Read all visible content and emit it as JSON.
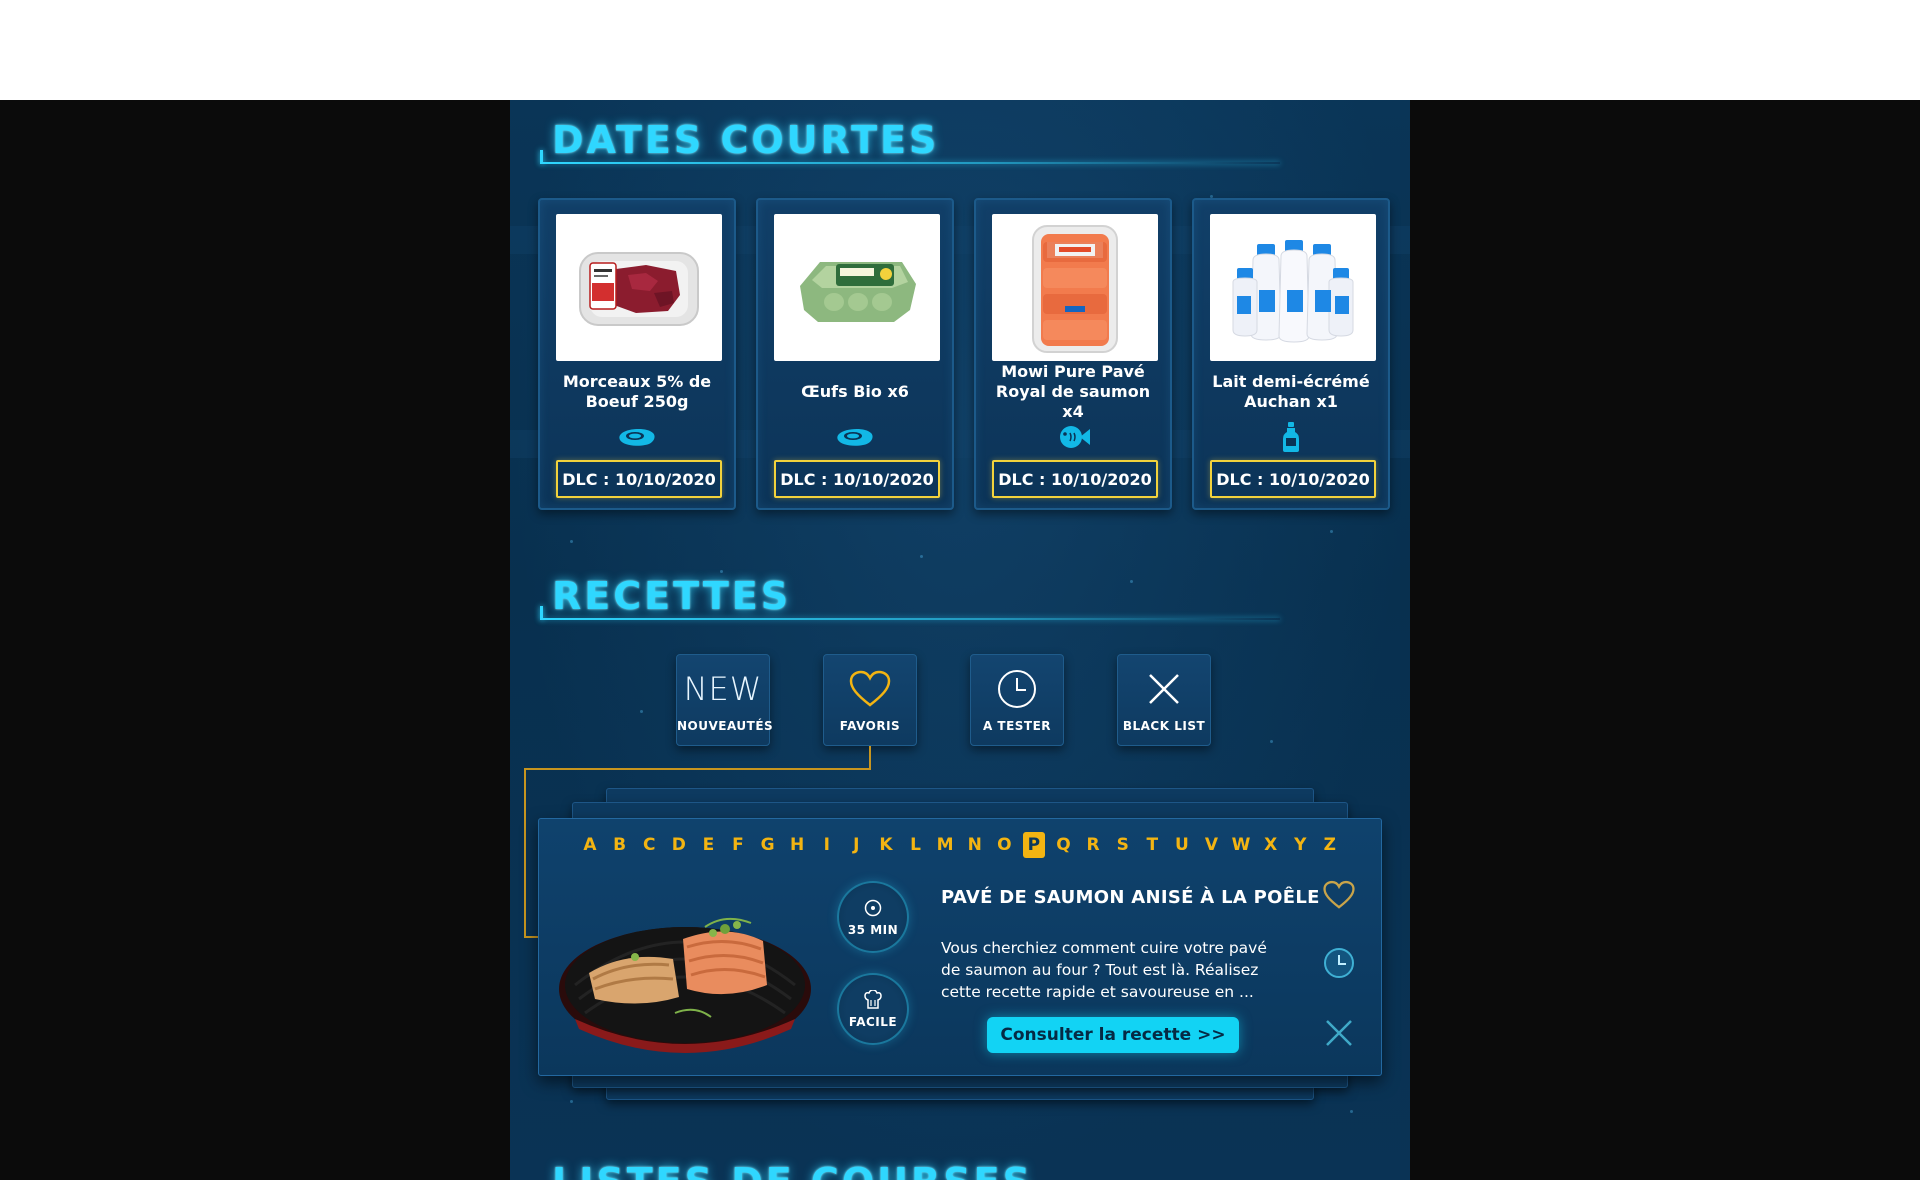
{
  "sections": {
    "dates_courtes": {
      "title": "Dates courtes"
    },
    "recettes": {
      "title": "Recettes"
    },
    "next_partial": {
      "title": "Listes de courses"
    }
  },
  "products": [
    {
      "name": "Morceaux 5% de Boeuf 250g",
      "dlc": "DLC : 10/10/2020",
      "category_icon": "meat-icon",
      "image": "beef-pack"
    },
    {
      "name": "Œufs Bio x6",
      "dlc": "DLC : 10/10/2020",
      "category_icon": "meat-icon",
      "image": "egg-carton"
    },
    {
      "name": "Mowi Pure Pavé Royal de saumon x4",
      "dlc": "DLC : 10/10/2020",
      "category_icon": "fish-icon",
      "image": "salmon-pack"
    },
    {
      "name": "Lait demi-écrémé Auchan x1",
      "dlc": "DLC : 10/10/2020",
      "category_icon": "bottle-icon",
      "image": "milk-bottles"
    }
  ],
  "filters": [
    {
      "label": "NOUVEAUTÉS",
      "icon": "new-icon",
      "icon_text": "NEW"
    },
    {
      "label": "FAVORIS",
      "icon": "heart-icon"
    },
    {
      "label": "A TESTER",
      "icon": "clock-icon"
    },
    {
      "label": "BLACK LIST",
      "icon": "cross-icon"
    }
  ],
  "alphabet": [
    "A",
    "B",
    "C",
    "D",
    "E",
    "F",
    "G",
    "H",
    "I",
    "J",
    "K",
    "L",
    "M",
    "N",
    "O",
    "P",
    "Q",
    "R",
    "S",
    "T",
    "U",
    "V",
    "W",
    "X",
    "Y",
    "Z"
  ],
  "alphabet_active": "P",
  "recipe": {
    "title": "PAVÉ DE SAUMON ANISÉ À LA POÊLE",
    "description": "Vous cherchiez comment cuire votre pavé de saumon au four ? Tout est là. Réalisez cette recette rapide et savoureuse en ...",
    "duration": "35 MIN",
    "difficulty": "FACILE",
    "cta": "Consulter la recette  >>"
  },
  "colors": {
    "panel_bg": "#08304f",
    "accent_cyan": "#2fd7ff",
    "accent_yellow": "#f3b412",
    "dlc_border": "#f2d23c",
    "cta_bg": "#12d3f4",
    "outside_bg": "#0b0b0b"
  }
}
